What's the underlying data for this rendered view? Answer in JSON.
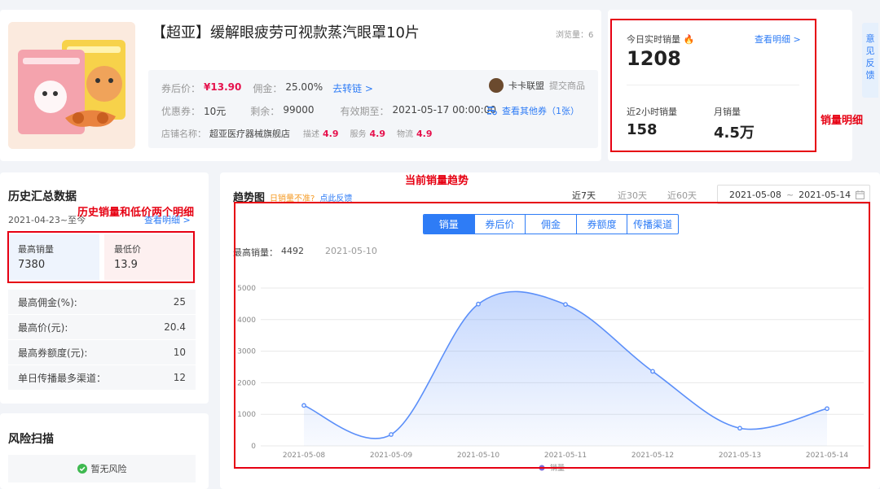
{
  "product": {
    "title": "【超亚】缓解眼疲劳可视款蒸汽眼罩10片",
    "views": "浏览量：6",
    "price_label": "券后价：",
    "price": "¥13.90",
    "commission_label": "佣金：",
    "commission": "25.00%",
    "convert_link": "去转链 >",
    "coupon_label": "优惠券：",
    "coupon": "10元",
    "remaining_label": "剩余：",
    "remaining": "99000",
    "valid_label": "有效期至：",
    "valid_until": "2021-05-17 00:00:00",
    "shop_label": "店铺名称：",
    "shop_name": "超亚医疗器械旗舰店",
    "desc_label": "描述",
    "desc_score": "4.9",
    "service_label": "服务",
    "service_score": "4.9",
    "logistics_label": "物流",
    "logistics_score": "4.9",
    "alliance": "卡卡联盟",
    "submit": "提交商品",
    "other_coupons": "查看其他券（1张）"
  },
  "sales": {
    "today_label": "今日实时销量",
    "today_value": "1208",
    "view_detail": "查看明细 >",
    "two_hour_label": "近2小时销量",
    "two_hour_value": "158",
    "month_label": "月销量",
    "month_value": "4.5万"
  },
  "feedback_tab": "意见反馈",
  "annotations": {
    "sales_detail": "销量明细",
    "current_trend": "当前销量趋势",
    "history_detail": "历史销量和低价两个明细"
  },
  "history": {
    "title": "历史汇总数据",
    "date_range": "2021-04-23~至今",
    "view_detail": "查看明细 >",
    "max_sales_label": "最高销量",
    "max_sales_value": "7380",
    "min_price_label": "最低价",
    "min_price_value": "13.9",
    "rows": [
      {
        "label": "最高佣金(%):",
        "value": "25"
      },
      {
        "label": "最高价(元):",
        "value": "20.4"
      },
      {
        "label": "最高券额度(元):",
        "value": "10"
      },
      {
        "label": "单日传播最多渠道：",
        "value": "12"
      }
    ]
  },
  "risk": {
    "title": "风险扫描",
    "status": "暂无风险"
  },
  "trend": {
    "title": "趋势图",
    "inaccurate": "日销量不准?",
    "feedback": "点此反馈",
    "ranges": [
      "近7天",
      "近30天",
      "近60天"
    ],
    "date_start": "2021-05-08",
    "date_sep": "~",
    "date_end": "2021-05-14",
    "tabs": [
      "销量",
      "券后价",
      "佣金",
      "券额度",
      "传播渠道"
    ],
    "max_label": "最高销量：",
    "max_value": "4492",
    "max_date": "2021-05-10",
    "legend": "销量"
  },
  "chart_data": {
    "type": "area",
    "x": [
      "2021-05-08",
      "2021-05-09",
      "2021-05-10",
      "2021-05-11",
      "2021-05-12",
      "2021-05-13",
      "2021-05-14"
    ],
    "series": [
      {
        "name": "销量",
        "values": [
          1280,
          360,
          4492,
          4480,
          2360,
          560,
          1180
        ]
      }
    ],
    "yticks": [
      0,
      1000,
      2000,
      3000,
      4000,
      5000
    ],
    "ylim": [
      0,
      5000
    ],
    "color": "#5b8ff9",
    "legend_position": "bottom"
  },
  "colors": {
    "accent": "#2e7cf6",
    "price": "#e6124d",
    "annotation": "#e60012"
  }
}
